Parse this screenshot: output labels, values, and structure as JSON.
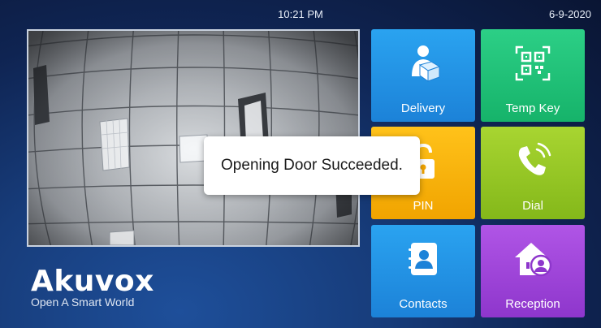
{
  "status_bar": {
    "time": "10:21 PM",
    "date": "6-9-2020"
  },
  "brand": {
    "name": "Akuvox",
    "tagline": "Open A Smart World"
  },
  "tiles": [
    {
      "label": "Delivery",
      "icon": "delivery-person-icon",
      "color": "#1c82d8"
    },
    {
      "label": "Temp Key",
      "icon": "qr-code-icon",
      "color": "#16b36a"
    },
    {
      "label": "PIN",
      "icon": "padlock-icon",
      "color": "#f1a400"
    },
    {
      "label": "Dial",
      "icon": "phone-ringing-icon",
      "color": "#84b81a"
    },
    {
      "label": "Contacts",
      "icon": "contact-book-icon",
      "color": "#1c82d8"
    },
    {
      "label": "Reception",
      "icon": "home-person-icon",
      "color": "#8e36cc"
    }
  ],
  "toast": {
    "message": "Opening Door Succeeded."
  }
}
